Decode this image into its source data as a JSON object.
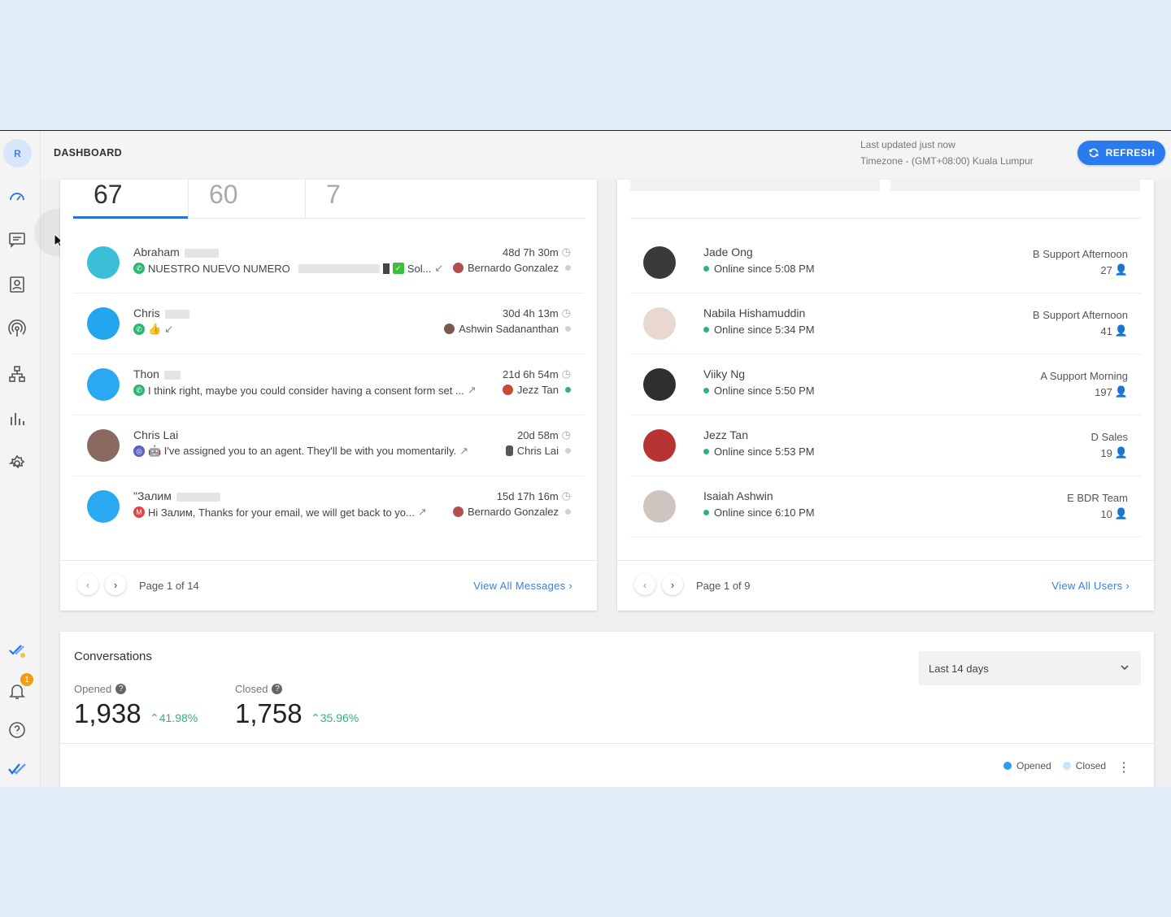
{
  "header": {
    "avatar_initial": "R",
    "title": "DASHBOARD",
    "last_updated": "Last updated just now",
    "timezone": "Timezone - (GMT+08:00) Kuala Lumpur",
    "refresh_label": "REFRESH"
  },
  "sidebar": {
    "items": [
      "dashboard-icon",
      "messages-icon",
      "contacts-icon",
      "broadcast-icon",
      "workflows-icon",
      "reports-icon",
      "settings-icon"
    ],
    "bottom": [
      "getting-started-icon",
      "notifications-icon",
      "help-icon",
      "logo-icon"
    ],
    "notification_count": "1"
  },
  "messages": {
    "tabs": [
      "67",
      "60",
      "7"
    ],
    "rows": [
      {
        "name": "Abraham",
        "time": "48d 7h 30m",
        "channel": "whatsapp",
        "message": "NUESTRO NUEVO NUMERO",
        "suffix": "Sol...",
        "agent": "Bernardo Gonzalez",
        "online": false
      },
      {
        "name": "Chris",
        "time": "30d 4h 13m",
        "channel": "whatsapp",
        "message": "👍",
        "suffix": "",
        "agent": "Ashwin Sadananthan",
        "online": false
      },
      {
        "name": "Thon",
        "time": "21d 6h 54m",
        "channel": "whatsapp",
        "message": "I think right, maybe you could consider having a consent form set ...",
        "suffix": "",
        "agent": "Jezz Tan",
        "online": true
      },
      {
        "name": "Chris Lai",
        "time": "20d 58m",
        "channel": "webchat",
        "message": "🤖 I've assigned you to an agent. They'll be with you momentarily.",
        "suffix": "",
        "agent": "Chris Lai",
        "online": false
      },
      {
        "name": "\"Залим",
        "time": "15d 17h 16m",
        "channel": "email",
        "message": "Hi Залим, Thanks for your email, we will get back to yo...",
        "suffix": "",
        "agent": "Bernardo Gonzalez",
        "online": false
      }
    ],
    "page": "Page 1 of 14",
    "view_all": "View All Messages"
  },
  "users": {
    "rows": [
      {
        "name": "Jade Ong",
        "status": "Online since 5:08 PM",
        "team": "B Support Afternoon",
        "count": "27"
      },
      {
        "name": "Nabila Hishamuddin",
        "status": "Online since 5:34 PM",
        "team": "B Support Afternoon",
        "count": "41"
      },
      {
        "name": "Viiky Ng",
        "status": "Online since 5:50 PM",
        "team": "A Support Morning",
        "count": "197"
      },
      {
        "name": "Jezz Tan",
        "status": "Online since 5:53 PM",
        "team": "D Sales",
        "count": "19"
      },
      {
        "name": "Isaiah Ashwin",
        "status": "Online since 6:10 PM",
        "team": "E BDR Team",
        "count": "10"
      }
    ],
    "page": "Page 1 of 9",
    "view_all": "View All Users"
  },
  "conversations": {
    "title": "Conversations",
    "opened_label": "Opened",
    "opened_value": "1,938",
    "opened_change": "41.98%",
    "closed_label": "Closed",
    "closed_value": "1,758",
    "closed_change": "35.96%",
    "range": "Last 14 days",
    "legend": [
      {
        "label": "Opened",
        "color": "#2f9cf0"
      },
      {
        "label": "Closed",
        "color": "#c8e2fb"
      }
    ]
  }
}
